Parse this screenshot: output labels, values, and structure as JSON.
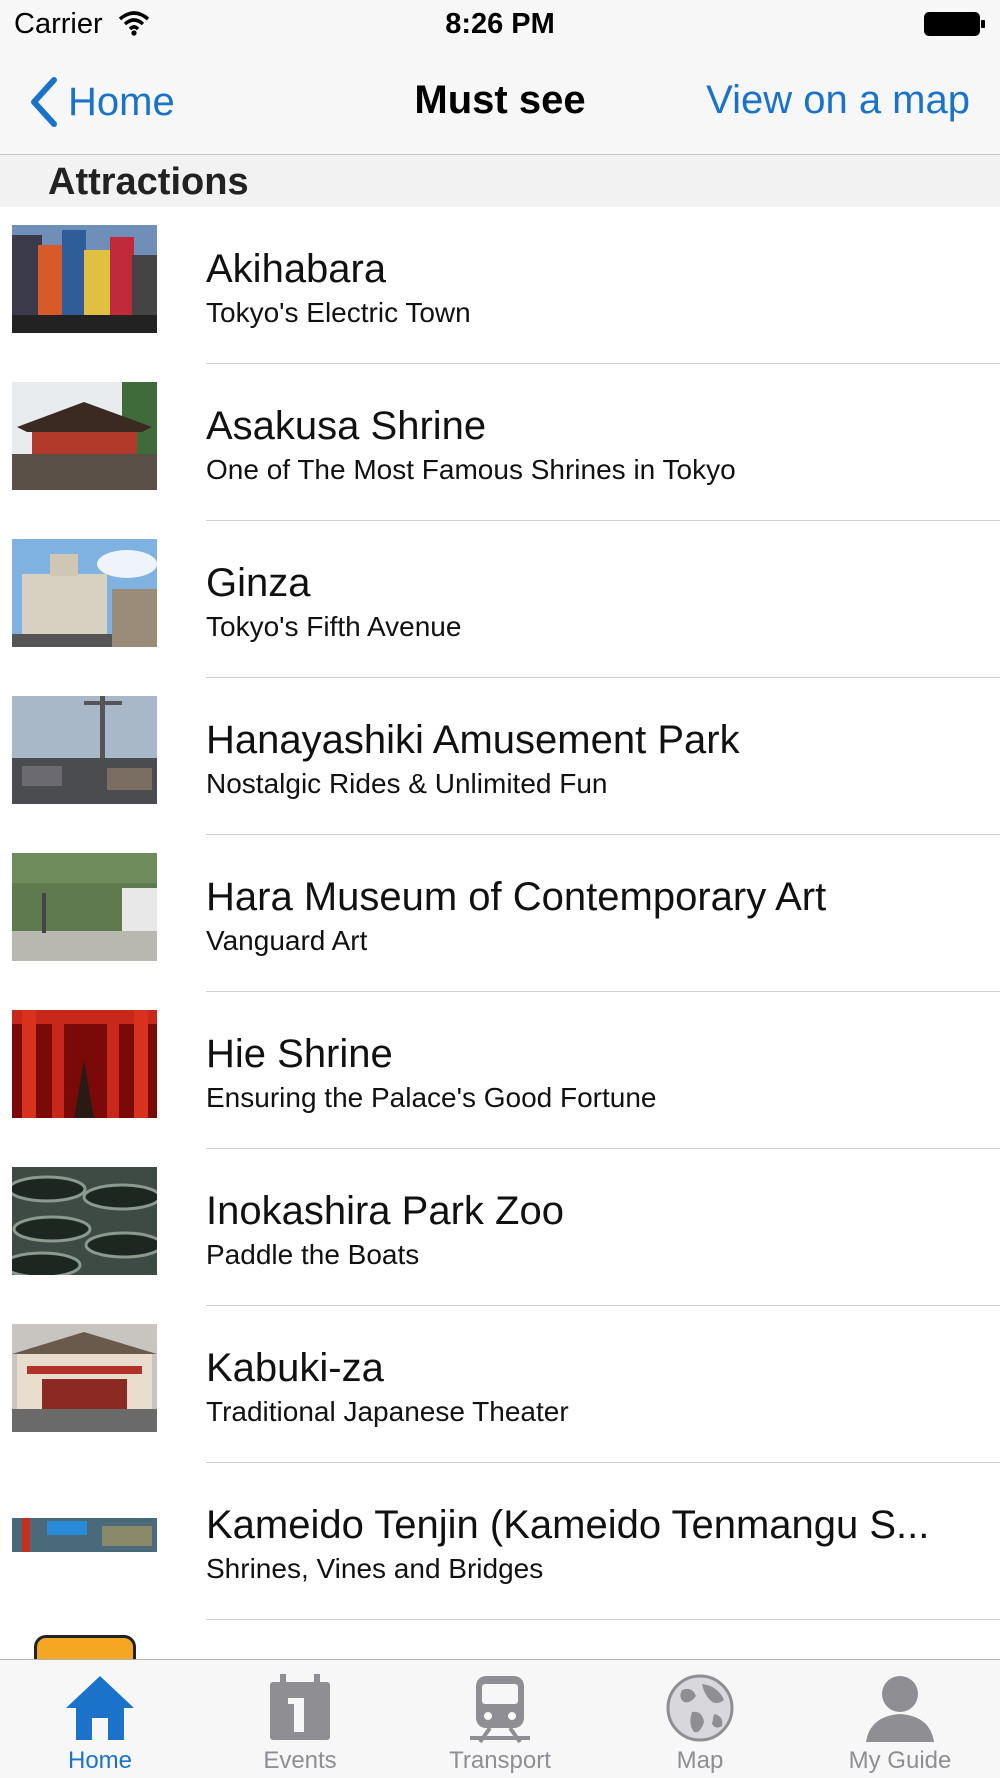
{
  "status_bar": {
    "carrier": "Carrier",
    "time": "8:26 PM"
  },
  "nav": {
    "back_label": "Home",
    "title": "Must see",
    "right_label": "View on a map"
  },
  "section": {
    "title": "Attractions"
  },
  "rows": [
    {
      "title": "Akihabara",
      "subtitle": "Tokyo's Electric Town",
      "icon": "akihabara-photo"
    },
    {
      "title": "Asakusa Shrine",
      "subtitle": "One of The Most Famous Shrines in Tokyo",
      "icon": "shrine-photo"
    },
    {
      "title": "Ginza",
      "subtitle": "Tokyo's Fifth Avenue",
      "icon": "ginza-photo"
    },
    {
      "title": "Hanayashiki Amusement Park",
      "subtitle": "Nostalgic Rides & Unlimited Fun",
      "icon": "amusement-park-photo"
    },
    {
      "title": "Hara Museum of Contemporary Art",
      "subtitle": "Vanguard Art",
      "icon": "museum-photo"
    },
    {
      "title": "Hie Shrine",
      "subtitle": "Ensuring the Palace's Good Fortune",
      "icon": "torii-photo"
    },
    {
      "title": "Inokashira Park Zoo",
      "subtitle": "Paddle the Boats",
      "icon": "boats-photo"
    },
    {
      "title": "Kabuki-za",
      "subtitle": "Traditional Japanese Theater",
      "icon": "theater-photo"
    },
    {
      "title": "Kameido Tenjin (Kameido Tenmangu S...",
      "subtitle": "Shrines, Vines and Bridges",
      "icon": "tenjin-photo"
    }
  ],
  "tabs": [
    {
      "label": "Home",
      "icon": "home-icon",
      "active": true
    },
    {
      "label": "Events",
      "icon": "calendar-icon",
      "active": false
    },
    {
      "label": "Transport",
      "icon": "train-icon",
      "active": false
    },
    {
      "label": "Map",
      "icon": "globe-icon",
      "active": false
    },
    {
      "label": "My Guide",
      "icon": "person-icon",
      "active": false
    }
  ],
  "colors": {
    "accent": "#1a73c8",
    "inactive_tab": "#8e8e93",
    "bar_background": "#f7f7f7"
  }
}
